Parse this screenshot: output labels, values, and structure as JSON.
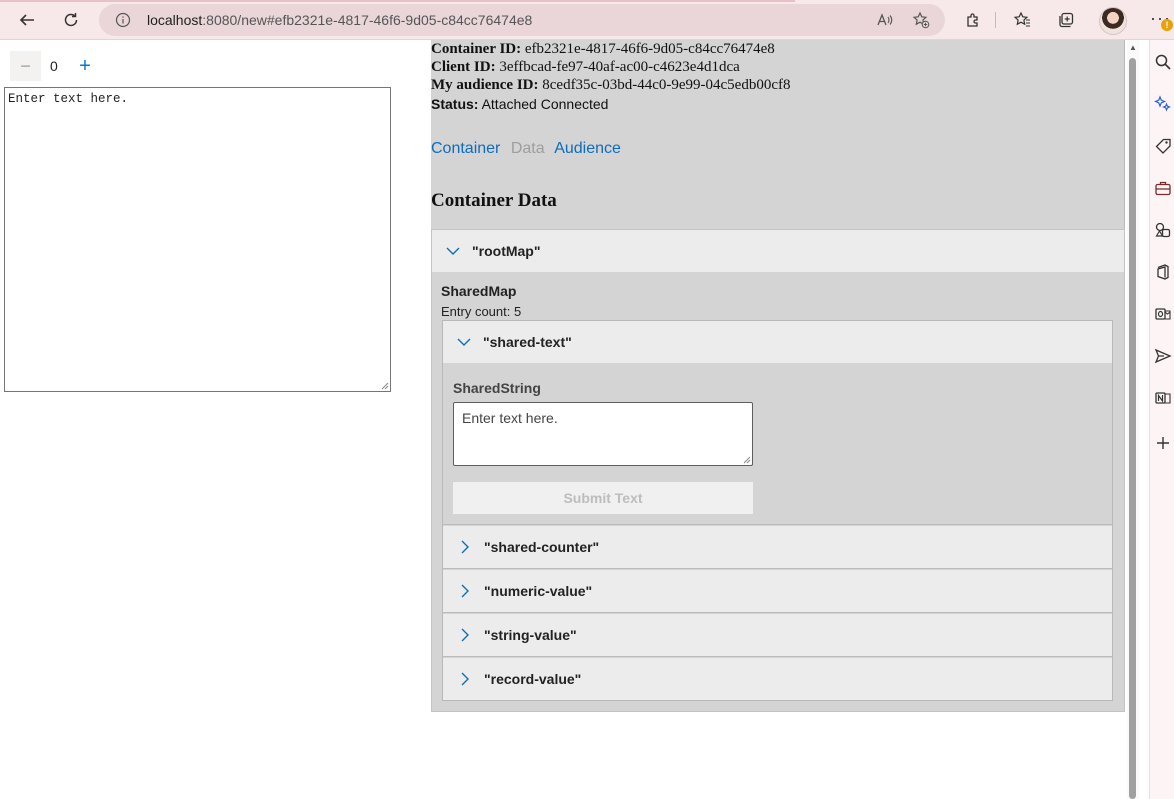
{
  "browser": {
    "url_host": "localhost",
    "url_rest": ":8080/new#efb2321e-4817-46f6-9d05-c84cc76474e8",
    "notification_count": "!",
    "more_label": "···"
  },
  "left_pane": {
    "counter_value": "0",
    "minus_label": "−",
    "plus_label": "+",
    "textarea_text": "Enter text here."
  },
  "debug": {
    "container_id_label": "Container ID:",
    "container_id": "efb2321e-4817-46f6-9d05-c84cc76474e8",
    "client_id_label": "Client ID:",
    "client_id": "3effbcad-fe97-40af-ac00-c4623e4d1dca",
    "audience_id_label": "My audience ID:",
    "audience_id": "8cedf35c-03bd-44c0-9e99-04c5edb00cf8",
    "status_label": "Status:",
    "status_value": "Attached Connected",
    "tabs": [
      {
        "label": "Container",
        "active": false
      },
      {
        "label": "Data",
        "active": true
      },
      {
        "label": "Audience",
        "active": false
      }
    ],
    "heading": "Container Data",
    "root": {
      "key": "\"rootMap\"",
      "type": "SharedMap",
      "entry_count": "Entry count: 5",
      "entries": [
        {
          "key": "\"shared-text\"",
          "expanded": true
        },
        {
          "key": "\"shared-counter\"",
          "expanded": false
        },
        {
          "key": "\"numeric-value\"",
          "expanded": false
        },
        {
          "key": "\"string-value\"",
          "expanded": false
        },
        {
          "key": "\"record-value\"",
          "expanded": false
        }
      ],
      "shared_text": {
        "type": "SharedString",
        "textarea_value": "Enter text here.",
        "submit_label": "Submit Text"
      }
    }
  }
}
